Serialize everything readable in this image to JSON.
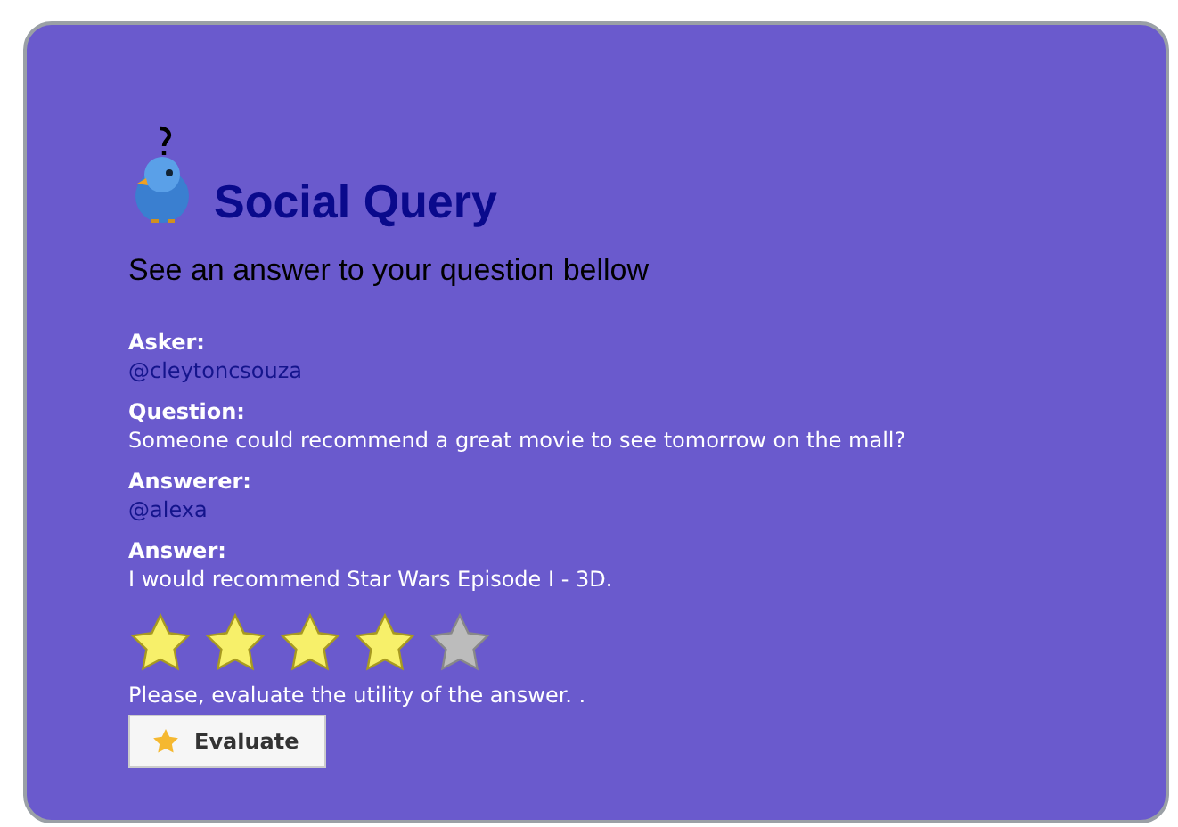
{
  "title": "Social Query",
  "subtitle": "See an answer to your question bellow",
  "fields": [
    {
      "label": "Asker:",
      "value": "@cleytoncsouza",
      "kind": "handle"
    },
    {
      "label": "Question:",
      "value": "Someone could recommend a great movie to see tomorrow on the mall?",
      "kind": "text"
    },
    {
      "label": "Answerer:",
      "value": "@alexa",
      "kind": "handle"
    },
    {
      "label": "Answer:",
      "value": "I would recommend Star Wars Episode I - 3D.",
      "kind": "text"
    }
  ],
  "rating": {
    "stars": 4,
    "hint": "Please, evaluate the utility of the answer. ."
  },
  "button": "Evaluate"
}
